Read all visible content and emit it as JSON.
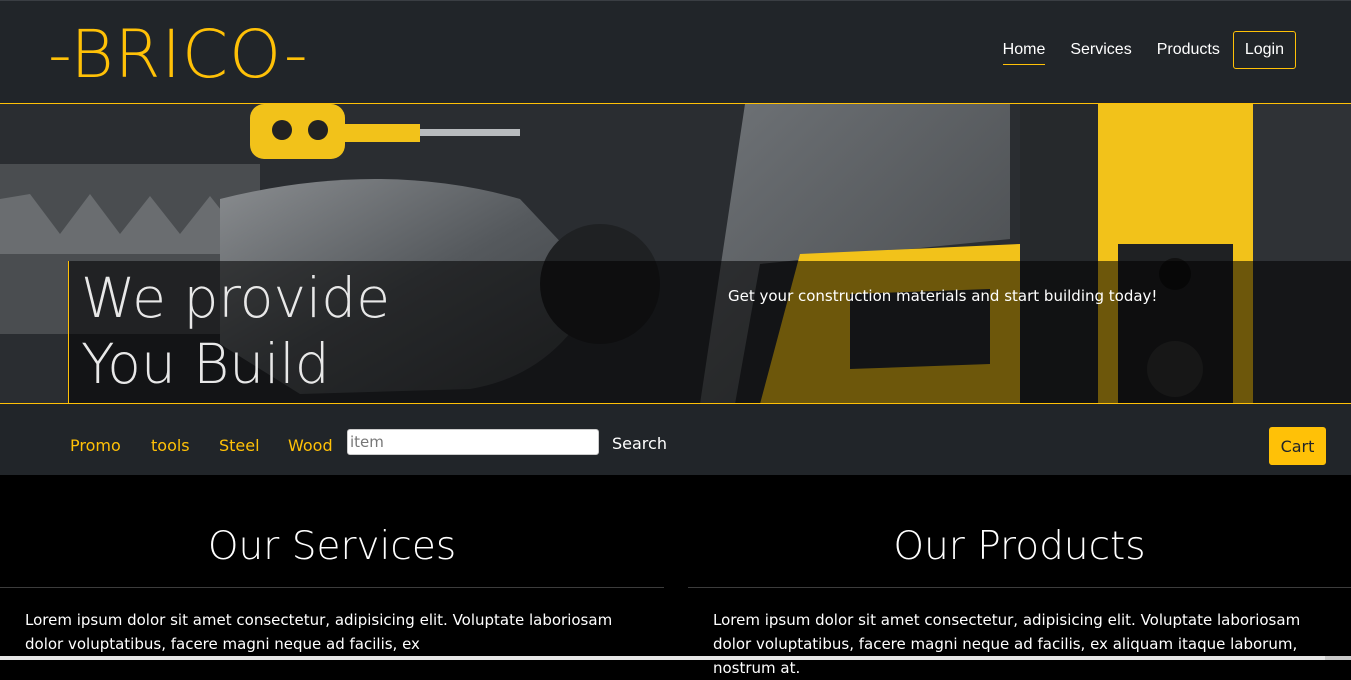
{
  "brand": {
    "logo": "-BRICO-",
    "accent": "#ffc107",
    "dark": "#212529"
  },
  "nav": {
    "items": [
      {
        "label": "Home"
      },
      {
        "label": "Services"
      },
      {
        "label": "Products"
      }
    ],
    "login_label": "Login"
  },
  "hero": {
    "title_line1": "We provide",
    "title_line2": "You Build",
    "subtitle": "Get your construction materials and start building today!"
  },
  "categories": {
    "items": [
      {
        "label": "Promo"
      },
      {
        "label": "tools"
      },
      {
        "label": "Steel"
      },
      {
        "label": "Wood"
      }
    ],
    "search_placeholder": "item",
    "search_label": "Search",
    "cart_label": "Cart"
  },
  "services": {
    "title": "Our Services",
    "text": "Lorem ipsum dolor sit amet consectetur, adipisicing elit. Voluptate laboriosam dolor voluptatibus, facere magni neque ad facilis, ex"
  },
  "products": {
    "title": "Our Products",
    "text": "Lorem ipsum dolor sit amet consectetur, adipisicing elit. Voluptate laboriosam dolor voluptatibus, facere magni neque ad facilis, ex aliquam itaque laborum, nostrum at."
  }
}
